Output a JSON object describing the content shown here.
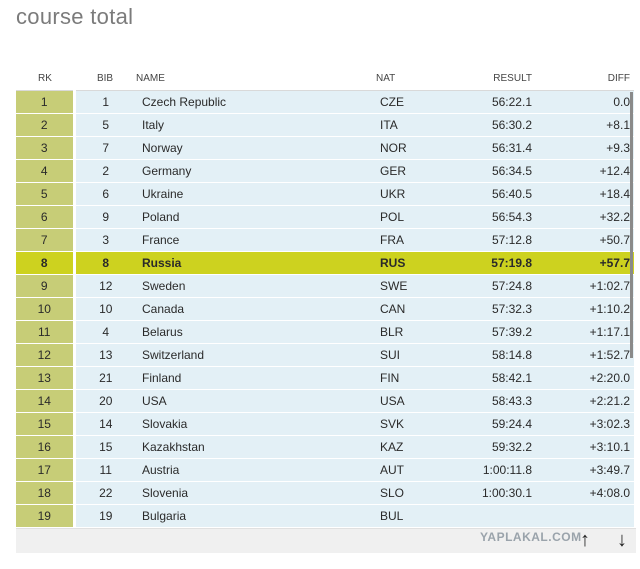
{
  "page": {
    "title": "course total"
  },
  "table": {
    "headers": {
      "rk": "RK",
      "bib": "BIB",
      "name": "NAME",
      "nat": "NAT",
      "result": "RESULT",
      "diff": "DIFF"
    },
    "highlight_rank": "8",
    "rows": [
      {
        "rk": "1",
        "bib": "1",
        "name": "Czech Republic",
        "nat": "CZE",
        "result": "56:22.1",
        "diff": "0.0"
      },
      {
        "rk": "2",
        "bib": "5",
        "name": "Italy",
        "nat": "ITA",
        "result": "56:30.2",
        "diff": "+8.1"
      },
      {
        "rk": "3",
        "bib": "7",
        "name": "Norway",
        "nat": "NOR",
        "result": "56:31.4",
        "diff": "+9.3"
      },
      {
        "rk": "4",
        "bib": "2",
        "name": "Germany",
        "nat": "GER",
        "result": "56:34.5",
        "diff": "+12.4"
      },
      {
        "rk": "5",
        "bib": "6",
        "name": "Ukraine",
        "nat": "UKR",
        "result": "56:40.5",
        "diff": "+18.4"
      },
      {
        "rk": "6",
        "bib": "9",
        "name": "Poland",
        "nat": "POL",
        "result": "56:54.3",
        "diff": "+32.2"
      },
      {
        "rk": "7",
        "bib": "3",
        "name": "France",
        "nat": "FRA",
        "result": "57:12.8",
        "diff": "+50.7"
      },
      {
        "rk": "8",
        "bib": "8",
        "name": "Russia",
        "nat": "RUS",
        "result": "57:19.8",
        "diff": "+57.7"
      },
      {
        "rk": "9",
        "bib": "12",
        "name": "Sweden",
        "nat": "SWE",
        "result": "57:24.8",
        "diff": "+1:02.7"
      },
      {
        "rk": "10",
        "bib": "10",
        "name": "Canada",
        "nat": "CAN",
        "result": "57:32.3",
        "diff": "+1:10.2"
      },
      {
        "rk": "11",
        "bib": "4",
        "name": "Belarus",
        "nat": "BLR",
        "result": "57:39.2",
        "diff": "+1:17.1"
      },
      {
        "rk": "12",
        "bib": "13",
        "name": "Switzerland",
        "nat": "SUI",
        "result": "58:14.8",
        "diff": "+1:52.7"
      },
      {
        "rk": "13",
        "bib": "21",
        "name": "Finland",
        "nat": "FIN",
        "result": "58:42.1",
        "diff": "+2:20.0"
      },
      {
        "rk": "14",
        "bib": "20",
        "name": "USA",
        "nat": "USA",
        "result": "58:43.3",
        "diff": "+2:21.2"
      },
      {
        "rk": "15",
        "bib": "14",
        "name": "Slovakia",
        "nat": "SVK",
        "result": "59:24.4",
        "diff": "+3:02.3"
      },
      {
        "rk": "16",
        "bib": "15",
        "name": "Kazakhstan",
        "nat": "KAZ",
        "result": "59:32.2",
        "diff": "+3:10.1"
      },
      {
        "rk": "17",
        "bib": "11",
        "name": "Austria",
        "nat": "AUT",
        "result": "1:00:11.8",
        "diff": "+3:49.7"
      },
      {
        "rk": "18",
        "bib": "22",
        "name": "Slovenia",
        "nat": "SLO",
        "result": "1:00:30.1",
        "diff": "+4:08.0"
      },
      {
        "rk": "19",
        "bib": "19",
        "name": "Bulgaria",
        "nat": "BUL",
        "result": "",
        "diff": ""
      }
    ]
  },
  "watermark": "YAPLAKAL.COM",
  "icons": {
    "up": "arrow-up-icon",
    "down": "arrow-down-icon"
  },
  "colors": {
    "rank_cell": "#c7cd77",
    "row_bg": "#e3f0f6",
    "highlight": "#cdd21f"
  }
}
